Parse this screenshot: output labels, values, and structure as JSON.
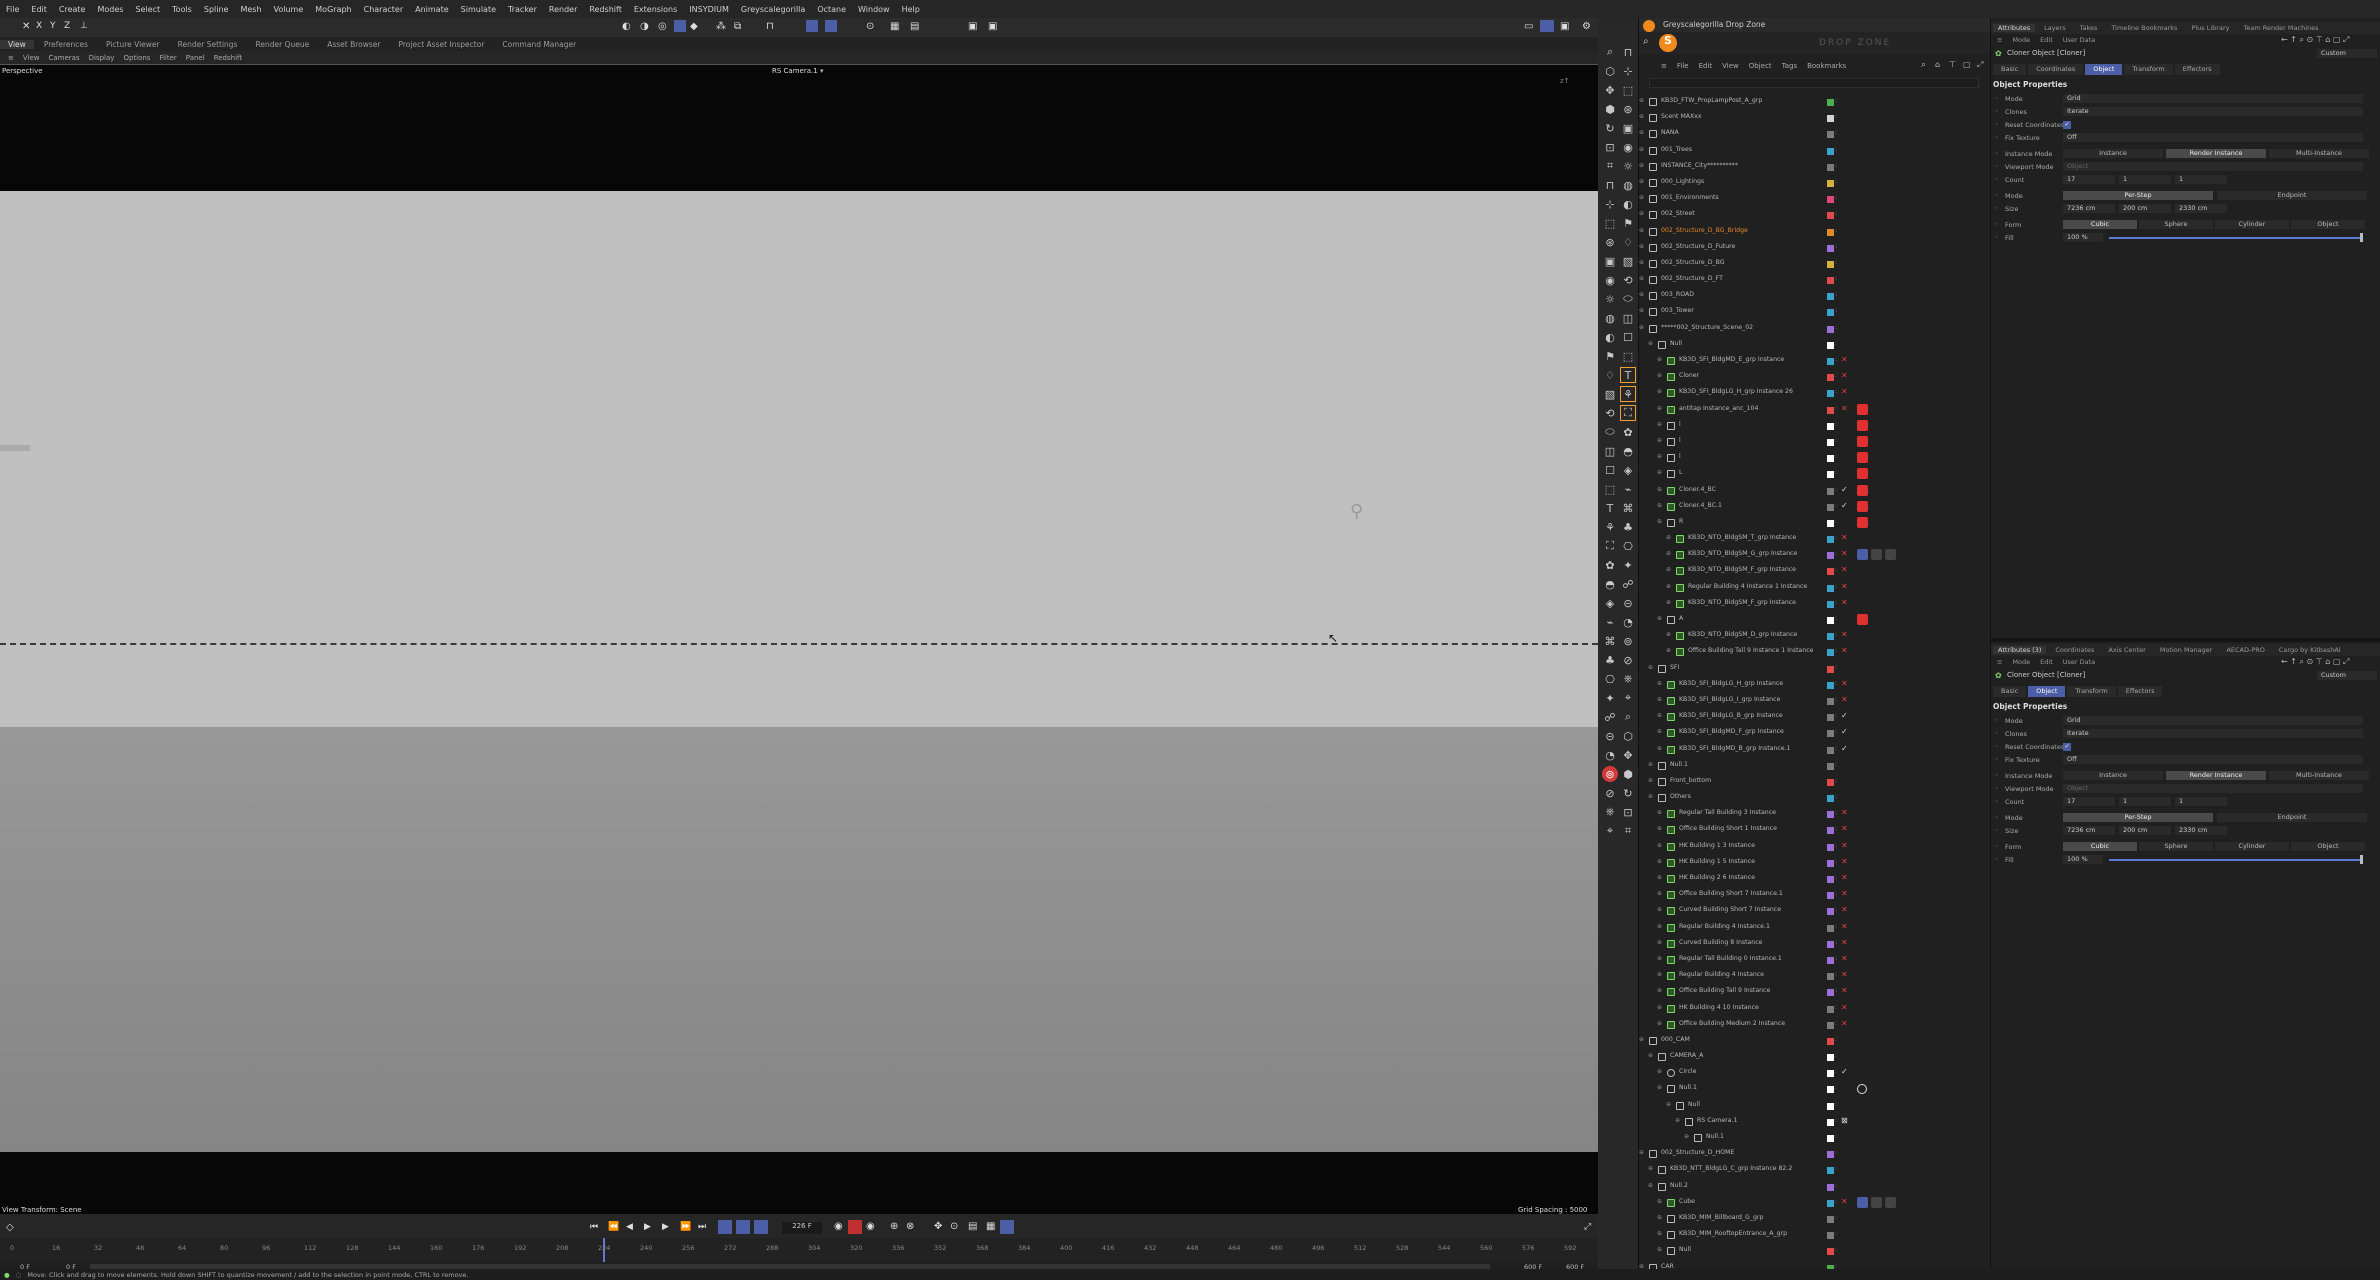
{
  "menu": [
    "File",
    "Edit",
    "Create",
    "Modes",
    "Select",
    "Tools",
    "Spline",
    "Mesh",
    "Volume",
    "MoGraph",
    "Character",
    "Animate",
    "Simulate",
    "Tracker",
    "Render",
    "Redshift",
    "Extensions",
    "INSYDIUM",
    "Greyscalegorilla",
    "Octane",
    "Window",
    "Help"
  ],
  "tabs": [
    "View",
    "Preferences",
    "Picture Viewer",
    "Render Settings",
    "Render Queue",
    "Asset Browser",
    "Project Asset Inspector",
    "Command Manager"
  ],
  "viewport_menu": [
    "View",
    "Cameras",
    "Display",
    "Options",
    "Filter",
    "Panel",
    "Redshift"
  ],
  "viewport": {
    "label": "Perspective",
    "camera": "RS Camera.1",
    "footer_left": "View Transform: Scene",
    "footer_right": "Grid Spacing : 5000 cm"
  },
  "timeline": {
    "ticks": [
      "0",
      "16",
      "32",
      "48",
      "64",
      "80",
      "96",
      "112",
      "128",
      "144",
      "160",
      "176",
      "192",
      "208",
      "224",
      "240",
      "256",
      "272",
      "288",
      "304",
      "320",
      "336",
      "352",
      "368",
      "384",
      "400",
      "416",
      "432",
      "448",
      "464",
      "480",
      "496",
      "512",
      "528",
      "544",
      "560",
      "576",
      "592"
    ],
    "current_frame": "226 F",
    "start": "0 F",
    "start2": "0 F",
    "end": "600 F",
    "end2": "600 F"
  },
  "status": "Move: Click and drag to move elements. Hold down SHIFT to quantize movement / add to the selection in point mode, CTRL to remove.",
  "object_manager": {
    "title": "Greyscalegorilla Drop Zone",
    "watermark": "DROP ZONE",
    "menu": [
      "File",
      "Edit",
      "View",
      "Object",
      "Tags",
      "Bookmarks"
    ],
    "items": [
      {
        "d": 0,
        "n": "KB3D_FTW_PropLampPost_A_grp",
        "c": "#4caf50",
        "icon": "null"
      },
      {
        "d": 0,
        "n": "Scent MAXxx",
        "c": "#d4d4d4",
        "icon": "null"
      },
      {
        "d": 0,
        "n": "NANA",
        "c": "#7c7c7c",
        "icon": "null"
      },
      {
        "d": 0,
        "n": "001_Trees",
        "c": "#3aa3c9",
        "icon": "null"
      },
      {
        "d": 0,
        "n": "INSTANCE_City**********",
        "c": "#7a7a7a",
        "icon": "null"
      },
      {
        "d": 0,
        "n": "000_Lightings",
        "c": "#d2b23a",
        "icon": "null"
      },
      {
        "d": 0,
        "n": "001_Environments",
        "c": "#e0457b",
        "icon": "null"
      },
      {
        "d": 0,
        "n": "002_Street",
        "c": "#e24b4b",
        "icon": "null"
      },
      {
        "d": 0,
        "n": "002_Structure_D_BG_Bridge",
        "c": "#e08a2a",
        "icon": "null",
        "orange": true
      },
      {
        "d": 0,
        "n": "002_Structure_D_Future",
        "c": "#9d6fd6",
        "icon": "null"
      },
      {
        "d": 0,
        "n": "002_Structure_D_BG",
        "c": "#d3b13a",
        "icon": "null"
      },
      {
        "d": 0,
        "n": "002_Structure_D_FT",
        "c": "#e24b4b",
        "icon": "null"
      },
      {
        "d": 0,
        "n": "003_ROAD",
        "c": "#3aa3c9",
        "icon": "null"
      },
      {
        "d": 0,
        "n": "003_Tower",
        "c": "#3aa3c9",
        "icon": "null"
      },
      {
        "d": 0,
        "n": "*****002_Structure_Scene_02",
        "c": "#9d6fd6",
        "icon": "null"
      },
      {
        "d": 1,
        "n": "Null",
        "c": "#ffffff",
        "icon": "null"
      },
      {
        "d": 2,
        "n": "KB3D_SFI_BldgMD_E_grp Instance",
        "c": "#3aa3c9",
        "icon": "gen",
        "st": "x"
      },
      {
        "d": 2,
        "n": "Cloner",
        "c": "#e24b4b",
        "icon": "gen",
        "st": "x"
      },
      {
        "d": 2,
        "n": "KB3D_SFI_BldgLG_H_grp Instance 26",
        "c": "#3aa3c9",
        "icon": "gen",
        "st": "x"
      },
      {
        "d": 2,
        "n": "antitap Instance_anc_104",
        "c": "#e24b4b",
        "icon": "gen",
        "st": "x",
        "badge": true
      },
      {
        "d": 2,
        "n": "l",
        "c": "#ffffff",
        "icon": "null",
        "badge": true
      },
      {
        "d": 2,
        "n": "l",
        "c": "#ffffff",
        "icon": "null",
        "badge": true
      },
      {
        "d": 2,
        "n": "l",
        "c": "#ffffff",
        "icon": "null",
        "badge": true
      },
      {
        "d": 2,
        "n": "L",
        "c": "#ffffff",
        "icon": "null",
        "badge": true
      },
      {
        "d": 2,
        "n": "Cloner.4_BC",
        "c": "#7c7c7c",
        "icon": "gen",
        "st": "v",
        "badge": true
      },
      {
        "d": 2,
        "n": "Cloner.4_BC.1",
        "c": "#7c7c7c",
        "icon": "gen",
        "st": "v",
        "badge": true
      },
      {
        "d": 2,
        "n": "R",
        "c": "#ffffff",
        "icon": "null",
        "badge": true
      },
      {
        "d": 3,
        "n": "KB3D_NTO_BldgSM_T_grp Instance",
        "c": "#3aa3c9",
        "icon": "gen",
        "st": "x"
      },
      {
        "d": 3,
        "n": "KB3D_NTO_BldgSM_G_grp Instance",
        "c": "#9d6fd6",
        "icon": "gen",
        "st": "x",
        "cams": true
      },
      {
        "d": 3,
        "n": "KB3D_NTO_BldgSM_F_grp Instance",
        "c": "#e24b4b",
        "icon": "gen",
        "st": "x"
      },
      {
        "d": 3,
        "n": "Regular Building 4 Instance 1 Instance",
        "c": "#3aa3c9",
        "icon": "gen",
        "st": "x"
      },
      {
        "d": 3,
        "n": "KB3D_NTO_BldgSM_F_grp Instance",
        "c": "#3aa3c9",
        "icon": "gen",
        "st": "x"
      },
      {
        "d": 2,
        "n": "A",
        "c": "#ffffff",
        "icon": "null",
        "badge": true
      },
      {
        "d": 3,
        "n": "KB3D_NTO_BldgSM_D_grp Instance",
        "c": "#3aa3c9",
        "icon": "gen",
        "st": "x"
      },
      {
        "d": 3,
        "n": "Office Building Tall 9 Instance 1 Instance",
        "c": "#3aa3c9",
        "icon": "gen",
        "st": "x"
      },
      {
        "d": 1,
        "n": "SFI",
        "c": "#e24b4b",
        "icon": "null"
      },
      {
        "d": 2,
        "n": "KB3D_SFI_BldgLG_H_grp Instance",
        "c": "#3aa3c9",
        "icon": "gen",
        "st": "x"
      },
      {
        "d": 2,
        "n": "KB3D_SFI_BldgLG_I_grp Instance",
        "c": "#7c7c7c",
        "icon": "gen",
        "st": "x"
      },
      {
        "d": 2,
        "n": "KB3D_SFI_BldgLG_B_grp Instance",
        "c": "#7c7c7c",
        "icon": "gen",
        "st": "v"
      },
      {
        "d": 2,
        "n": "KB3D_SFI_BldgMD_F_grp Instance",
        "c": "#7c7c7c",
        "icon": "gen",
        "st": "v"
      },
      {
        "d": 2,
        "n": "KB3D_SFI_BldgMD_B_grp Instance.1",
        "c": "#7c7c7c",
        "icon": "gen",
        "st": "v"
      },
      {
        "d": 1,
        "n": "Null.1",
        "c": "#7c7c7c",
        "icon": "null"
      },
      {
        "d": 1,
        "n": "Front_bottom",
        "c": "#e24b4b",
        "icon": "null"
      },
      {
        "d": 1,
        "n": "Others",
        "c": "#3aa3c9",
        "icon": "null"
      },
      {
        "d": 2,
        "n": "Regular Tall Building 3 Instance",
        "c": "#9d6fd6",
        "icon": "gen",
        "st": "x"
      },
      {
        "d": 2,
        "n": "Office Building Short 1 Instance",
        "c": "#9d6fd6",
        "icon": "gen",
        "st": "x"
      },
      {
        "d": 2,
        "n": "HK Building 1 3 Instance",
        "c": "#9d6fd6",
        "icon": "gen",
        "st": "x"
      },
      {
        "d": 2,
        "n": "HK Building 1 5 Instance",
        "c": "#9d6fd6",
        "icon": "gen",
        "st": "x"
      },
      {
        "d": 2,
        "n": "HK Building 2 6 Instance",
        "c": "#9d6fd6",
        "icon": "gen",
        "st": "x"
      },
      {
        "d": 2,
        "n": "Office Building Short 7 Instance.1",
        "c": "#9d6fd6",
        "icon": "gen",
        "st": "x"
      },
      {
        "d": 2,
        "n": "Curved Building Short 7 Instance",
        "c": "#9d6fd6",
        "icon": "gen",
        "st": "x"
      },
      {
        "d": 2,
        "n": "Regular Building 4 Instance.1",
        "c": "#7c7c7c",
        "icon": "gen",
        "st": "x"
      },
      {
        "d": 2,
        "n": "Curved Building 8 Instance",
        "c": "#9d6fd6",
        "icon": "gen",
        "st": "x"
      },
      {
        "d": 2,
        "n": "Regular Tall Building 0 Instance.1",
        "c": "#9d6fd6",
        "icon": "gen",
        "st": "x"
      },
      {
        "d": 2,
        "n": "Regular Building 4 Instance",
        "c": "#7c7c7c",
        "icon": "gen",
        "st": "x"
      },
      {
        "d": 2,
        "n": "Office Building Tall 9 Instance",
        "c": "#9d6fd6",
        "icon": "gen",
        "st": "x"
      },
      {
        "d": 2,
        "n": "HK Building 4 10 Instance",
        "c": "#7c7c7c",
        "icon": "gen",
        "st": "x"
      },
      {
        "d": 2,
        "n": "Office Building Medium 2 Instance",
        "c": "#7c7c7c",
        "icon": "gen",
        "st": "x"
      },
      {
        "d": 0,
        "n": "000_CAM",
        "c": "#e24b4b",
        "icon": "null"
      },
      {
        "d": 1,
        "n": "CAMERA_A",
        "c": "#ffffff",
        "icon": "null"
      },
      {
        "d": 2,
        "n": "Circle",
        "c": "#ffffff",
        "icon": "ring",
        "st": "v"
      },
      {
        "d": 2,
        "n": "Null.1",
        "c": "#ffffff",
        "icon": "null",
        "cbadge": true
      },
      {
        "d": 3,
        "n": "Null",
        "c": "#ffffff",
        "icon": "null"
      },
      {
        "d": 4,
        "n": "RS Camera.1",
        "c": "#ffffff",
        "icon": "null",
        "st": "c"
      },
      {
        "d": 5,
        "n": "Null.1",
        "c": "#ffffff",
        "icon": "null"
      },
      {
        "d": 0,
        "n": "002_Structure_D_HOME",
        "c": "#9d6fd6",
        "icon": "null"
      },
      {
        "d": 1,
        "n": "KB3D_NTT_BldgLG_C_grp Instance 82.2",
        "c": "#3aa3c9",
        "icon": "null"
      },
      {
        "d": 1,
        "n": "Null.2",
        "c": "#9d6fd6",
        "icon": "null"
      },
      {
        "d": 2,
        "n": "Cube",
        "c": "#3aa3c9",
        "icon": "gen",
        "st": "x",
        "cams": true
      },
      {
        "d": 2,
        "n": "KB3D_MIM_Billboard_G_grp",
        "c": "#7c7c7c",
        "icon": "null"
      },
      {
        "d": 2,
        "n": "KB3D_MIM_RooftopEntrance_A_grp",
        "c": "#7c7c7c",
        "icon": "null"
      },
      {
        "d": 2,
        "n": "Null",
        "c": "#e24b4b",
        "icon": "null"
      },
      {
        "d": 0,
        "n": "CAR",
        "c": "#4caf50",
        "icon": "null"
      }
    ]
  },
  "attributes_top": {
    "tabs": [
      "Attributes",
      "Layers",
      "Takes",
      "Timeline Bookmarks",
      "Plus Library",
      "Team Render Machines"
    ],
    "mode": [
      "Mode",
      "Edit",
      "User Data"
    ],
    "title": "Cloner Object [Cloner]",
    "preset": "Custom",
    "subtabs": [
      "Basic",
      "Coordinates",
      "Object",
      "Transform",
      "Effectors"
    ],
    "active_subtab": "Object",
    "section": "Object Properties"
  },
  "attributes_bottom": {
    "tabs": [
      "Attributes (3)",
      "Coordinates",
      "Axis Center",
      "Motion Manager",
      "AECAD-PRO",
      "Cargo by KitbashAl"
    ],
    "mode": [
      "Mode",
      "Edit",
      "User Data"
    ],
    "title": "Cloner Object [Cloner]",
    "preset": "Custom",
    "subtabs": [
      "Basic",
      "Object",
      "Transform",
      "Effectors"
    ],
    "active_subtab": "Object",
    "section": "Object Properties"
  },
  "props": {
    "mode_label": "Mode",
    "mode_value": "Grid",
    "clones_label": "Clones",
    "clones_value": "Iterate",
    "reset_label": "Reset Coordinates",
    "fix_label": "Fix Texture",
    "fix_value": "Off",
    "instance_label": "Instance Mode",
    "instance_opts": [
      "Instance",
      "Render Instance",
      "Multi-Instance"
    ],
    "viewport_label": "Viewport Mode",
    "viewport_value": "Object",
    "count_label": "Count",
    "count": [
      "17",
      "1",
      "1"
    ],
    "mode2_label": "Mode",
    "mode2_opts": [
      "Per-Step",
      "Endpoint"
    ],
    "size_label": "Size",
    "size": [
      "7236 cm",
      "200 cm",
      "2330 cm"
    ],
    "form_label": "Form",
    "form_opts": [
      "Cubic",
      "Sphere",
      "Cylinder",
      "Object"
    ],
    "fill_label": "Fill",
    "fill_value": "100 %",
    "fill_fraction": 1.0
  }
}
